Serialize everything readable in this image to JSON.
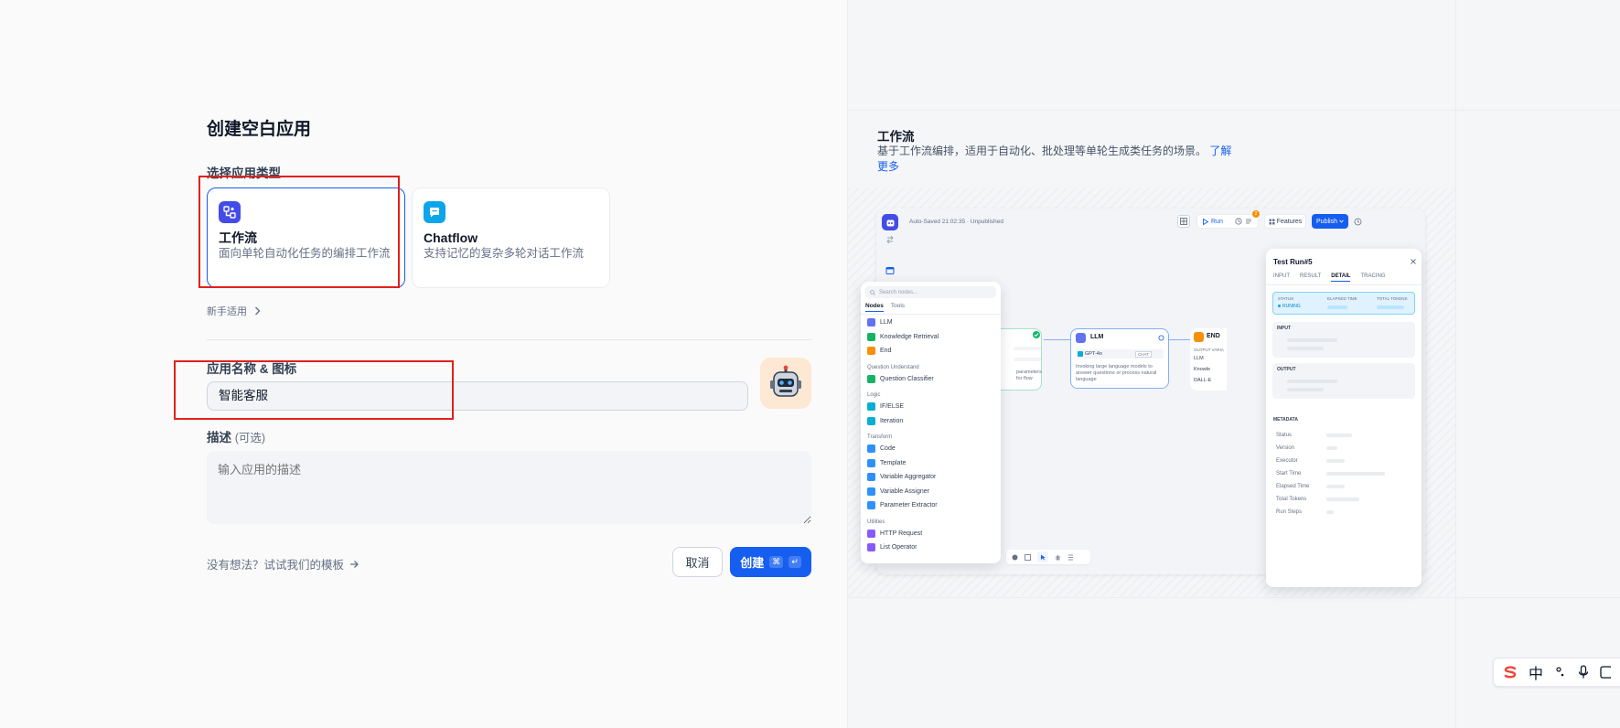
{
  "form": {
    "title": "创建空白应用",
    "type_label": "选择应用类型",
    "types": [
      {
        "name": "工作流",
        "desc": "面向单轮自动化任务的编排工作流"
      },
      {
        "name": "Chatflow",
        "desc": "支持记忆的复杂多轮对话工作流"
      }
    ],
    "beginner_label": "新手适用",
    "name_label": "应用名称 & 图标",
    "name_value": "智能客服",
    "desc_label": "描述",
    "desc_optional": "(可选)",
    "desc_placeholder": "输入应用的描述",
    "template_link": "没有想法？试试我们的模板",
    "cancel_label": "取消",
    "create_label": "创建",
    "create_kbd_1": "⌘",
    "create_kbd_2": "↵"
  },
  "preview": {
    "title": "工作流",
    "desc": "基于工作流编排，适用于自动化、批处理等单轮生成类任务的场景。",
    "learn_more": "了解更多",
    "autosave": "Auto-Saved 21:02:35 · Unpublished",
    "run": "Run",
    "features": "Features",
    "publish": "Publish",
    "badge": "2",
    "search_placeholder": "Search nodes...",
    "tabs": [
      "Nodes",
      "Tools"
    ],
    "menu": [
      {
        "label": "LLM",
        "color": "#6172f3"
      },
      {
        "label": "Knowledge Retrieval",
        "color": "#16b364"
      },
      {
        "label": "End",
        "color": "#f79009"
      },
      {
        "group": "Question Understand"
      },
      {
        "label": "Question Classifier",
        "color": "#16b364"
      },
      {
        "group": "Logic"
      },
      {
        "label": "IF/ELSE",
        "color": "#06aed4"
      },
      {
        "label": "Iteration",
        "color": "#06aed4"
      },
      {
        "group": "Transform"
      },
      {
        "label": "Code",
        "color": "#2e90fa"
      },
      {
        "label": "Template",
        "color": "#2e90fa"
      },
      {
        "label": "Variable Aggregator",
        "color": "#2e90fa"
      },
      {
        "label": "Variable Assigner",
        "color": "#2e90fa"
      },
      {
        "label": "Parameter Extractor",
        "color": "#2e90fa"
      },
      {
        "group": "Utilities"
      },
      {
        "label": "HTTP Request",
        "color": "#875bf7"
      },
      {
        "label": "List Operator",
        "color": "#875bf7"
      }
    ],
    "llm_node": {
      "title": "LLM",
      "model": "GPT-4o",
      "mode": "CHAT",
      "desc": "Invoking large language models to answer questions or process natural language"
    },
    "start_node_desc": "parameters for flow",
    "end_node": {
      "title": "END",
      "output_label": "OUTPUT VARIA",
      "items": [
        "LLM",
        "Knowle",
        "DALL-E"
      ]
    },
    "test_run": {
      "title": "Test Run#5",
      "tabs": [
        "INPUT",
        "RESULT",
        "DETAIL",
        "TRACING"
      ],
      "status_label": "STATUS",
      "status_value": "RUNING",
      "elapsed_label": "ELAPSED TIME",
      "tokens_label": "TOTAL TOKENS",
      "input_label": "INPUT",
      "output_label": "OUTPUT",
      "metadata_label": "METADATA",
      "meta_rows": [
        "Status",
        "Version",
        "Executor",
        "Start Time",
        "Elapsed Time",
        "Total Tokens",
        "Run Steps"
      ]
    }
  },
  "ime": {
    "zh": "中"
  }
}
